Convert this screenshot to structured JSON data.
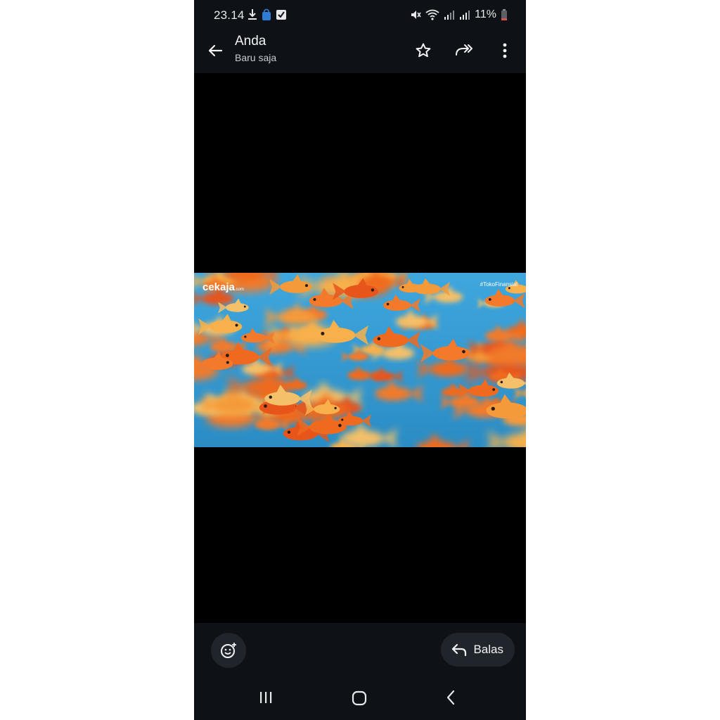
{
  "status_bar": {
    "time": "23.14",
    "battery": "11%",
    "icons": [
      "download-icon",
      "bag-icon",
      "check-icon",
      "mute-icon",
      "wifi-icon",
      "signal-icon",
      "signal-icon",
      "battery-icon"
    ]
  },
  "header": {
    "title": "Anda",
    "subtitle": "Baru saja",
    "actions": [
      "back-arrow-icon",
      "star-icon",
      "forward-icon",
      "more-vert-icon"
    ]
  },
  "media": {
    "brand": "cekaja",
    "brand_suffix": ".com",
    "hashtag": "#TokoFinansial",
    "description_icon": "goldfish-photo"
  },
  "footer": {
    "reply_label": "Balas",
    "emoji_icon": "add-reaction-icon",
    "reply_icon": "reply-icon"
  },
  "nav": {
    "buttons": [
      "recents-icon",
      "home-icon",
      "back-icon"
    ]
  },
  "colors": {
    "bar_bg": "#0e1216",
    "pill_bg": "#1f252b",
    "water": "#3aa0d8",
    "fish": "#f27a2a"
  }
}
